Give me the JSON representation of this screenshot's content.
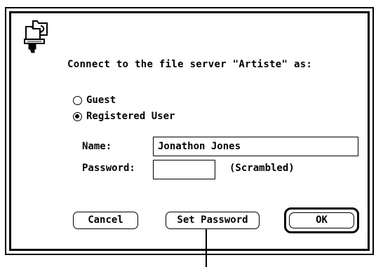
{
  "dialog": {
    "prompt": "Connect to the file server \"Artiste\" as:",
    "icon": "file-server-connect-icon"
  },
  "login_type": {
    "options": [
      {
        "label": "Guest",
        "selected": false
      },
      {
        "label": "Registered User",
        "selected": true
      }
    ]
  },
  "fields": {
    "name_label": "Name:",
    "name_value": "Jonathon Jones",
    "password_label": "Password:",
    "password_value": "",
    "password_note": "(Scrambled)"
  },
  "buttons": {
    "cancel": "Cancel",
    "set_password": "Set Password",
    "ok": "OK"
  }
}
